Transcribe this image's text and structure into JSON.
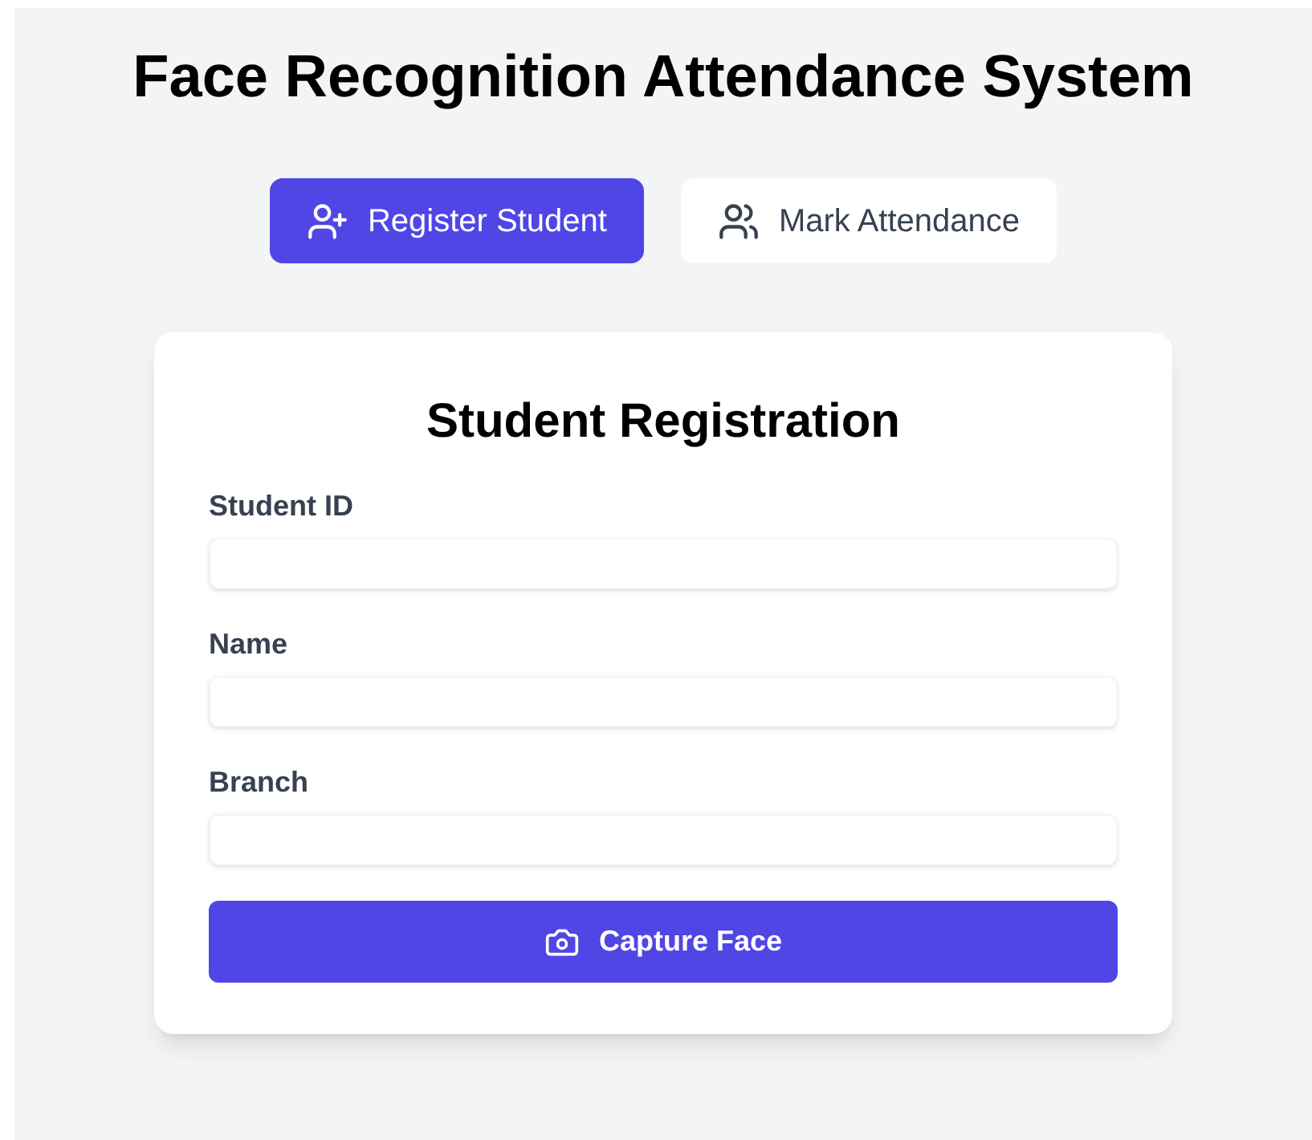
{
  "title": "Face Recognition Attendance System",
  "tabs": [
    {
      "label": "Register Student",
      "kind": "add-user",
      "selected": true
    },
    {
      "label": "Mark Attendance",
      "kind": "users",
      "selected": false
    }
  ],
  "form": {
    "title": "Student Registration",
    "fields": [
      {
        "label": "Student ID"
      },
      {
        "label": "Name"
      },
      {
        "label": "Branch"
      }
    ],
    "submit": {
      "label": "Capture Face"
    }
  }
}
